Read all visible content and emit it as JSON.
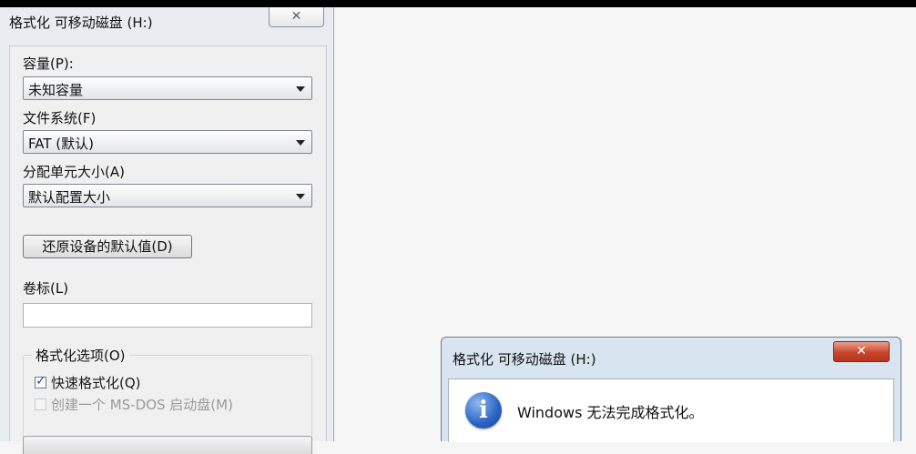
{
  "format_dialog": {
    "title": "格式化 可移动磁盘 (H:)",
    "close_glyph": "✕",
    "capacity": {
      "label": "容量(P):",
      "value": "未知容量"
    },
    "file_system": {
      "label": "文件系统(F)",
      "value": "FAT (默认)"
    },
    "allocation": {
      "label": "分配单元大小(A)",
      "value": "默认配置大小"
    },
    "restore_button": "还原设备的默认值(D)",
    "volume_label": {
      "label": "卷标(L)",
      "value": ""
    },
    "options": {
      "title": "格式化选项(O)",
      "quick_format": {
        "label": "快速格式化(Q)",
        "checked": true,
        "check_glyph": "✓"
      },
      "msdos_boot": {
        "label": "创建一个 MS-DOS 启动盘(M)",
        "checked": false,
        "enabled": false
      }
    }
  },
  "message_box": {
    "title": "格式化 可移动磁盘 (H:)",
    "close_glyph": "✕",
    "icon": "info-icon",
    "icon_glyph": "i",
    "message": "Windows 无法完成格式化。"
  }
}
